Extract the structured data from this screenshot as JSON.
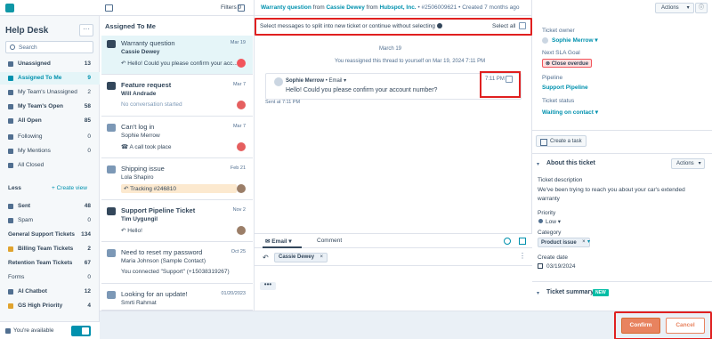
{
  "colors": {
    "accent": "#0091ae",
    "highlight_box": "#e02020",
    "confirm": "#e8835f",
    "nav_bg": "#2d3e50"
  },
  "top": {
    "filters_label": "Filters",
    "filters_count": "0"
  },
  "sidebar": {
    "title": "Help Desk",
    "more_label": "···",
    "search_placeholder": "Search",
    "items": [
      {
        "label": "Unassigned",
        "count": "13",
        "icon": "inbox-icon"
      },
      {
        "label": "Assigned To Me",
        "count": "9",
        "icon": "person-icon"
      },
      {
        "label": "My Team's Unassigned",
        "count": "2",
        "icon": "team-icon"
      },
      {
        "label": "My Team's Open",
        "count": "58",
        "icon": "team-icon"
      },
      {
        "label": "All Open",
        "count": "85",
        "icon": "inbox-icon"
      },
      {
        "label": "Following",
        "count": "0",
        "icon": "star-icon"
      },
      {
        "label": "My Mentions",
        "count": "0",
        "icon": "at-icon"
      },
      {
        "label": "All Closed",
        "count": "",
        "icon": "check-icon"
      }
    ],
    "less_label": "Less",
    "create_view_label": "+ Create view",
    "more_items": [
      {
        "label": "Sent",
        "count": "48",
        "icon": "send-icon"
      },
      {
        "label": "Spam",
        "count": "0",
        "icon": "spam-icon"
      },
      {
        "label": "General Support Tickets",
        "count": "134",
        "icon": ""
      },
      {
        "label": "Billing Team Tickets",
        "count": "2",
        "icon": "money-icon"
      },
      {
        "label": "Retention Team Tickets",
        "count": "67",
        "icon": ""
      },
      {
        "label": "Forms",
        "count": "0",
        "icon": ""
      },
      {
        "label": "AI Chatbot",
        "count": "12",
        "icon": "bot-icon"
      },
      {
        "label": "GS High Priority",
        "count": "4",
        "icon": "gs-icon"
      }
    ],
    "availability_label": "You're available"
  },
  "list": {
    "title": "Assigned To Me",
    "tickets": [
      {
        "title": "Warranty question",
        "date": "Mar 19",
        "contact": "Cassie Dewey",
        "preview": "↶ Hello! Could you please confirm your acc...",
        "selected": true
      },
      {
        "title": "Feature request",
        "date": "Mar 7",
        "contact": "Will Andrade",
        "preview": "No conversation started",
        "selected": false
      },
      {
        "title": "Can't log in",
        "date": "Mar 7",
        "contact": "Sophie Merrow",
        "preview": "☎ A call took place",
        "selected": false
      },
      {
        "title": "Shipping issue",
        "date": "Feb 21",
        "contact": "Lola Shapiro",
        "preview": "↶ Tracking #246810",
        "selected": false
      },
      {
        "title": "Support Pipeline Ticket",
        "date": "Nov 2",
        "contact": "Tim Uygungil",
        "preview": "↶ Hello!",
        "selected": false
      },
      {
        "title": "Need to reset my password",
        "date": "Oct 25",
        "contact": "Maria Johnson (Sample Contact)",
        "preview": "You connected \"Support\" (+15038319267)",
        "selected": false
      },
      {
        "title": "Looking for an update!",
        "date": "01/20/2023",
        "contact": "Smrti Rahmat",
        "preview": "",
        "selected": false
      }
    ]
  },
  "conversation": {
    "header": {
      "ticket_link": "Warranty question",
      "from_label": "from",
      "contact_link": "Cassie Dewey",
      "from_label2": "from",
      "company_link": "Hubspot, Inc.",
      "ticket_id": "• #2506009621",
      "created": "• Created 7 months ago"
    },
    "split_prompt": "Select messages to split into new ticket or continue without selecting",
    "select_all_label": "Select all",
    "date_divider": "March 19",
    "reassign_note": "You reassigned this thread to yourself on Mar 19, 2024 7:11 PM",
    "message": {
      "sender": "Sophie Merrow",
      "channel": "• Email",
      "body": "Hello! Could you please confirm your account number?",
      "time": "7:11 PM"
    },
    "sent_note": "Sent at 7:11 PM",
    "composer": {
      "tab_email": "Email",
      "tab_comment": "Comment",
      "to_recipient": "Cassie Dewey",
      "more_label": "•••"
    }
  },
  "details": {
    "actions_label": "Actions",
    "ticket_owner_label": "Ticket owner",
    "ticket_owner": "Sophie Merrow",
    "sla_label": "Next SLA Goal",
    "sla_value": "Close overdue",
    "pipeline_label": "Pipeline",
    "pipeline_value": "Support Pipeline",
    "status_label": "Ticket status",
    "status_value": "Waiting on contact",
    "create_task_label": "Create a task",
    "about_title": "About this ticket",
    "about_actions_label": "Actions",
    "description_label": "Ticket description",
    "description": "We've been trying to reach you about your car's extended warranty",
    "priority_label": "Priority",
    "priority_value": "Low",
    "category_label": "Category",
    "category_value": "Product issue",
    "create_date_label": "Create date",
    "create_date_value": "03/19/2024",
    "summary_title": "Ticket summary",
    "summary_badge": "NEW"
  },
  "footer": {
    "confirm_label": "Confirm",
    "cancel_label": "Cancel"
  }
}
